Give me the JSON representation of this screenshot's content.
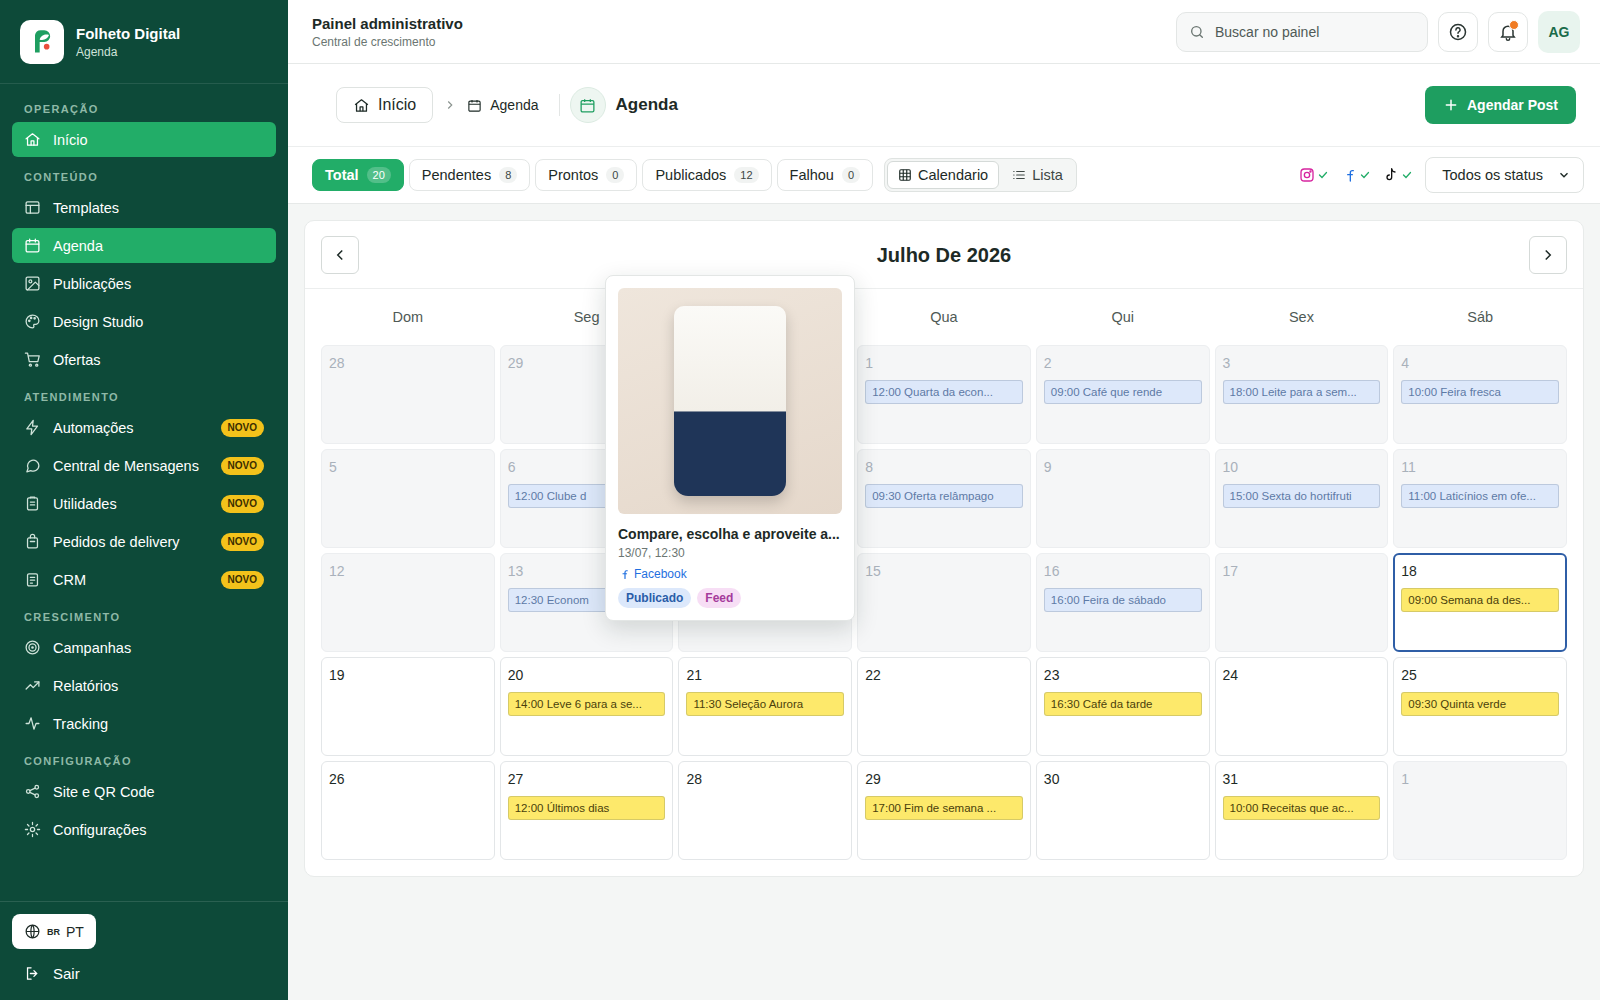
{
  "brand": {
    "title": "Folheto Digital",
    "subtitle": "Agenda"
  },
  "sidebar": {
    "sections": [
      {
        "label": "OPERAÇÃO",
        "items": [
          {
            "label": "Início",
            "selected": true
          }
        ]
      },
      {
        "label": "CONTEÚDO",
        "items": [
          {
            "label": "Templates",
            "selected": false
          },
          {
            "label": "Agenda",
            "selected": true
          },
          {
            "label": "Publicações",
            "selected": false
          },
          {
            "label": "Design Studio",
            "selected": false
          },
          {
            "label": "Ofertas",
            "selected": false
          }
        ]
      },
      {
        "label": "ATENDIMENTO",
        "items": [
          {
            "label": "Automações",
            "selected": false,
            "badge": "NOVO"
          },
          {
            "label": "Central de Mensagens",
            "selected": false,
            "badge": "NOVO"
          },
          {
            "label": "Utilidades",
            "selected": false,
            "badge": "NOVO"
          },
          {
            "label": "Pedidos de delivery",
            "selected": false,
            "badge": "NOVO"
          },
          {
            "label": "CRM",
            "selected": false,
            "badge": "NOVO"
          }
        ]
      },
      {
        "label": "CRESCIMENTO",
        "items": [
          {
            "label": "Campanhas",
            "selected": false
          },
          {
            "label": "Relatórios",
            "selected": false
          },
          {
            "label": "Tracking",
            "selected": false
          }
        ]
      },
      {
        "label": "CONFIGURAÇÃO",
        "items": [
          {
            "label": "Site e QR Code",
            "selected": false
          },
          {
            "label": "Configurações",
            "selected": false
          }
        ]
      }
    ],
    "language": {
      "flag": "BR",
      "label": "PT"
    },
    "logout": "Sair"
  },
  "header": {
    "title": "Painel administrativo",
    "subtitle": "Central de crescimento",
    "search_placeholder": "Buscar no painel",
    "notification_unread": true,
    "avatar": "AG"
  },
  "breadcrumb": [
    "Início",
    "Agenda"
  ],
  "page_title": "Agenda",
  "primary_button": "Agendar Post",
  "filters": [
    {
      "label": "Total",
      "count": "20",
      "selected": true
    },
    {
      "label": "Pendentes",
      "count": "8",
      "selected": false
    },
    {
      "label": "Prontos",
      "count": "0",
      "selected": false
    },
    {
      "label": "Publicados",
      "count": "12",
      "selected": false
    },
    {
      "label": "Falhou",
      "count": "0",
      "selected": false
    }
  ],
  "views": [
    {
      "label": "Calendario",
      "selected": true
    },
    {
      "label": "Lista",
      "selected": false
    }
  ],
  "channels": [
    {
      "connected": true
    },
    {
      "connected": true
    },
    {
      "connected": true
    }
  ],
  "status_select": "Todos os status",
  "calendar": {
    "month": "Julho De 2026",
    "weekdays": [
      "Dom",
      "Seg",
      "",
      "Qua",
      "Qui",
      "Sex",
      "Sáb"
    ],
    "weeks": [
      [
        {
          "day": "28",
          "muted": true,
          "selected": false,
          "events": []
        },
        {
          "day": "29",
          "muted": true,
          "selected": false,
          "events": []
        },
        {
          "day": "",
          "muted": true,
          "selected": false,
          "events": []
        },
        {
          "day": "1",
          "muted": true,
          "selected": false,
          "events": [
            {
              "label": "12:00 Quarta da econ...",
              "color": "#dde8fa",
              "text_color": "#5d7aa6"
            }
          ]
        },
        {
          "day": "2",
          "muted": true,
          "selected": false,
          "events": [
            {
              "label": "09:00 Café que rende",
              "color": "#dde8fa",
              "text_color": "#5d7aa6"
            }
          ]
        },
        {
          "day": "3",
          "muted": true,
          "selected": false,
          "events": [
            {
              "label": "18:00 Leite para a sem...",
              "color": "#dde8fa",
              "text_color": "#5d7aa6"
            }
          ]
        },
        {
          "day": "4",
          "muted": true,
          "selected": false,
          "events": [
            {
              "label": "10:00 Feira fresca",
              "color": "#dde8fa",
              "text_color": "#5d7aa6"
            }
          ]
        }
      ],
      [
        {
          "day": "5",
          "muted": true,
          "selected": false,
          "events": []
        },
        {
          "day": "6",
          "muted": true,
          "selected": false,
          "events": [
            {
              "label": "12:00 Clube d",
              "color": "#dde8fa",
              "text_color": "#5d7aa6"
            }
          ]
        },
        {
          "day": "",
          "muted": true,
          "selected": false,
          "events": []
        },
        {
          "day": "8",
          "muted": true,
          "selected": false,
          "events": [
            {
              "label": "09:30 Oferta relâmpago",
              "color": "#dde8fa",
              "text_color": "#5d7aa6"
            }
          ]
        },
        {
          "day": "9",
          "muted": true,
          "selected": false,
          "events": []
        },
        {
          "day": "10",
          "muted": true,
          "selected": false,
          "events": [
            {
              "label": "15:00 Sexta do hortifruti",
              "color": "#dde8fa",
              "text_color": "#5d7aa6"
            }
          ]
        },
        {
          "day": "11",
          "muted": true,
          "selected": false,
          "events": [
            {
              "label": "11:00 Laticínios em ofe...",
              "color": "#dde8fa",
              "text_color": "#5d7aa6"
            }
          ]
        }
      ],
      [
        {
          "day": "12",
          "muted": true,
          "selected": false,
          "events": []
        },
        {
          "day": "13",
          "muted": true,
          "selected": false,
          "events": [
            {
              "label": "12:30 Econom",
              "color": "#dde8fa",
              "text_color": "#5d7aa6"
            }
          ]
        },
        {
          "day": "",
          "muted": true,
          "selected": false,
          "events": []
        },
        {
          "day": "15",
          "muted": true,
          "selected": false,
          "events": []
        },
        {
          "day": "16",
          "muted": true,
          "selected": false,
          "events": [
            {
              "label": "16:00 Feira de sábado",
              "color": "#dde8fa",
              "text_color": "#5d7aa6"
            }
          ]
        },
        {
          "day": "17",
          "muted": true,
          "selected": false,
          "events": []
        },
        {
          "day": "18",
          "muted": false,
          "selected": true,
          "events": [
            {
              "label": "09:00 Semana da des...",
              "color": "#fde96b",
              "text_color": "#4a3f0c"
            }
          ]
        }
      ],
      [
        {
          "day": "19",
          "muted": false,
          "selected": false,
          "events": []
        },
        {
          "day": "20",
          "muted": false,
          "selected": false,
          "events": [
            {
              "label": "14:00 Leve 6 para a se...",
              "color": "#fde96b",
              "text_color": "#4a3f0c"
            }
          ]
        },
        {
          "day": "21",
          "muted": false,
          "selected": false,
          "events": [
            {
              "label": "11:30 Seleção Aurora",
              "color": "#fde96b",
              "text_color": "#4a3f0c"
            }
          ]
        },
        {
          "day": "22",
          "muted": false,
          "selected": false,
          "events": []
        },
        {
          "day": "23",
          "muted": false,
          "selected": false,
          "events": [
            {
              "label": "16:30 Café da tarde",
              "color": "#fde96b",
              "text_color": "#4a3f0c"
            }
          ]
        },
        {
          "day": "24",
          "muted": false,
          "selected": false,
          "events": []
        },
        {
          "day": "25",
          "muted": false,
          "selected": false,
          "events": [
            {
              "label": "09:30 Quinta verde",
              "color": "#fde96b",
              "text_color": "#4a3f0c"
            }
          ]
        }
      ],
      [
        {
          "day": "26",
          "muted": false,
          "selected": false,
          "events": []
        },
        {
          "day": "27",
          "muted": false,
          "selected": false,
          "events": [
            {
              "label": "12:00 Últimos dias",
              "color": "#fde96b",
              "text_color": "#4a3f0c"
            }
          ]
        },
        {
          "day": "28",
          "muted": false,
          "selected": false,
          "events": []
        },
        {
          "day": "29",
          "muted": false,
          "selected": false,
          "events": [
            {
              "label": "17:00 Fim de semana ...",
              "color": "#fde96b",
              "text_color": "#4a3f0c"
            }
          ]
        },
        {
          "day": "30",
          "muted": false,
          "selected": false,
          "events": []
        },
        {
          "day": "31",
          "muted": false,
          "selected": false,
          "events": [
            {
              "label": "10:00 Receitas que ac...",
              "color": "#fde96b",
              "text_color": "#4a3f0c"
            }
          ]
        },
        {
          "day": "1",
          "muted": true,
          "selected": false,
          "events": []
        }
      ]
    ]
  },
  "popover": {
    "title": "Compare, escolha e aproveite a...",
    "date": "13/07, 12:30",
    "channel": "Facebook",
    "tags": [
      {
        "label": "Publicado",
        "color": "#dce8fb",
        "text_color": "#2a5da8"
      },
      {
        "label": "Feed",
        "color": "#f7def5",
        "text_color": "#a53b9b"
      }
    ]
  }
}
